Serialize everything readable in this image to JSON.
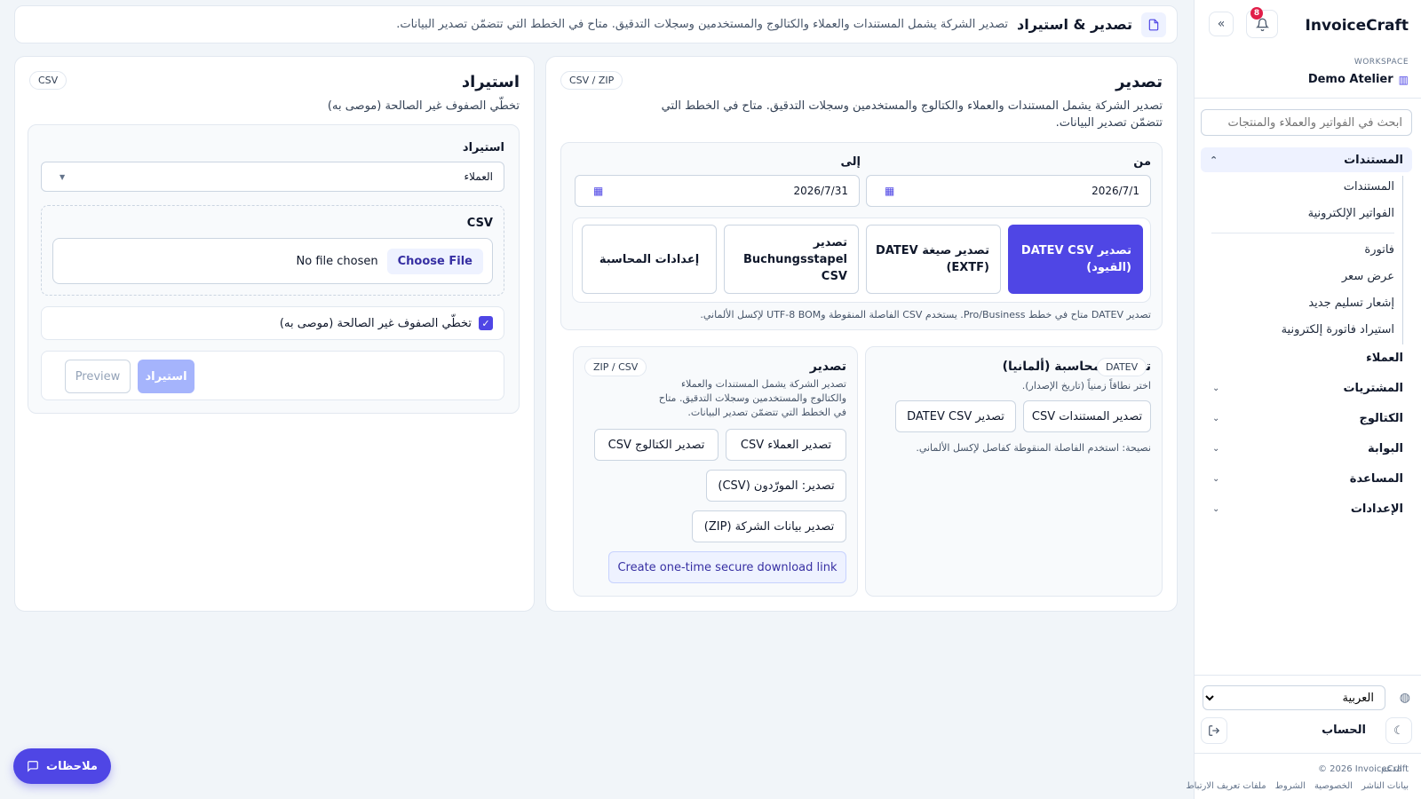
{
  "sidebar": {
    "brand": "InvoiceCraft",
    "notification_count": "8",
    "workspace_label": "WORKSPACE",
    "workspace_name": "Demo Atelier",
    "search_placeholder": "ابحث في الفواتير والعملاء والمنتجات",
    "documents_group": "المستندات",
    "documents_sub": [
      "المستندات",
      "الفواتير الإلكترونية"
    ],
    "create_sub": [
      "فاتورة",
      "عرض سعر",
      "إشعار تسليم جديد",
      "استيراد فاتورة إلكترونية"
    ],
    "nav": [
      "العملاء",
      "المشتريات",
      "الكتالوج",
      "البوابة",
      "المساعدة",
      "الإعدادات"
    ],
    "language": "العربية",
    "account": "الحساب",
    "copyright": "© 2026 InvoiceCraft",
    "support": "الدعم",
    "footer_links": [
      "بيانات الناشر",
      "الخصوصية",
      "الشروط",
      "ملفات تعريف الارتباط"
    ]
  },
  "topbar": {
    "title": "تصدير & استيراد",
    "description": "تصدير الشركة يشمل المستندات والعملاء والكتالوج والمستخدمين وسجلات التدقيق. متاح في الخطط التي تتضمّن تصدير البيانات."
  },
  "export": {
    "title": "تصدير",
    "chip": "CSV / ZIP",
    "description": "تصدير الشركة يشمل المستندات والعملاء والكتالوج والمستخدمين وسجلات التدقيق. متاح في الخطط التي تتضمّن تصدير البيانات.",
    "from_label": "من",
    "to_label": "إلى",
    "from_value": "2026/7/1",
    "to_value": "2026/7/31",
    "buttons": {
      "datev_csv": "تصدير DATEV CSV (القيود)",
      "datev_extf": "تصدير صيغة DATEV (EXTF)",
      "buchungsstapel": "تصدير Buchungsstapel CSV",
      "accounting_settings": "إعدادات المحاسبة"
    },
    "datev_note": "تصدير DATEV متاح في خطط Pro/Business. يستخدم CSV الفاصلة المنقوطة وUTF-8 BOM لإكسل الألماني.",
    "accounting": {
      "title": "تصدير المحاسبة (ألمانيا)",
      "chip": "DATEV",
      "hint": "اختر نطاقاً زمنياً (تاريخ الإصدار).",
      "documents_csv": "تصدير المستندات CSV",
      "datev_csv": "تصدير DATEV CSV",
      "tip": "نصيحة: استخدم الفاصلة المنقوطة كفاصل لإكسل الألماني."
    },
    "data": {
      "title": "تصدير",
      "chip": "ZIP / CSV",
      "description": "تصدير الشركة يشمل المستندات والعملاء والكتالوج والمستخدمين وسجلات التدقيق. متاح في الخطط التي تتضمّن تصدير البيانات.",
      "customers_csv": "تصدير العملاء CSV",
      "catalog_csv": "تصدير الكتالوج CSV",
      "suppliers_csv": "تصدير: المورّدون (CSV)",
      "company_zip": "تصدير بيانات الشركة (ZIP)",
      "secure_link": "Create one-time secure download link"
    }
  },
  "import": {
    "title": "استيراد",
    "chip": "CSV",
    "subtitle": "تخطّي الصفوف غير الصالحة (موصى به)",
    "import_label": "استيراد",
    "import_target": "العملاء",
    "csv_label": "CSV",
    "choose_file": "Choose File",
    "no_file": "No file chosen",
    "skip_invalid": "تخطّي الصفوف غير الصالحة (موصى به)",
    "import_button": "استيراد",
    "preview_button": "Preview"
  },
  "notes_button": "ملاحظات",
  "colors": {
    "accent": "#4f46e5",
    "badge": "#e11d48"
  }
}
